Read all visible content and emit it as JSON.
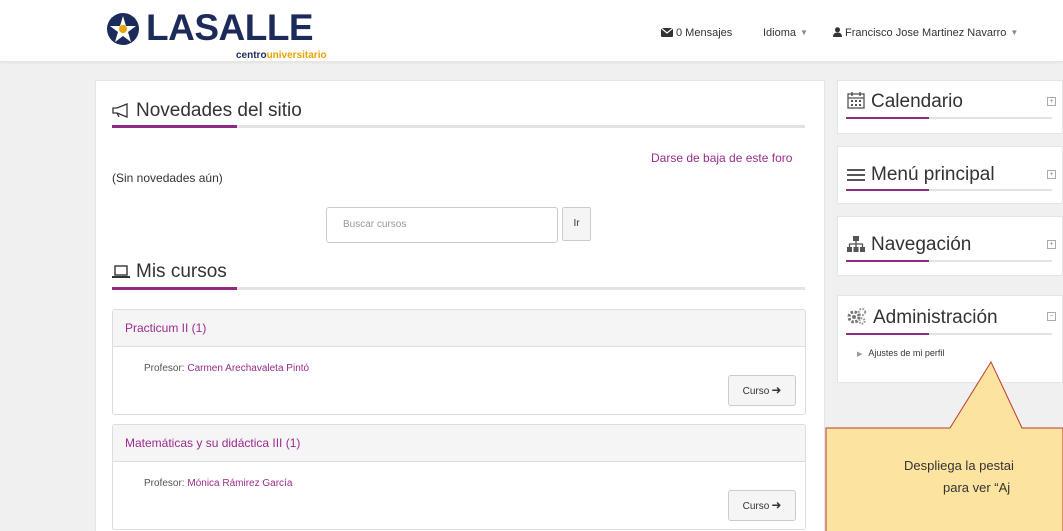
{
  "header": {
    "logo_text": "LASALLE",
    "logo_sub_a": "centro",
    "logo_sub_b": "universitario",
    "messages_label": "0 Mensajes",
    "language_label": "Idioma",
    "user_label": "Francisco Jose Martinez Navarro"
  },
  "news": {
    "title": "Novedades del sitio",
    "unsubscribe_link": "Darse de baja de este foro",
    "empty_text": "(Sin novedades aún)"
  },
  "search": {
    "placeholder": "Buscar cursos",
    "button_label": "Ir"
  },
  "my_courses": {
    "title": "Mis cursos",
    "courses": [
      {
        "name": "Practicum II (1)",
        "teacher_label": "Profesor: ",
        "teacher_name": "Carmen Arechavaleta Pintó",
        "button_label": "Curso"
      },
      {
        "name": "Matemáticas y su didáctica III (1)",
        "teacher_label": "Profesor: ",
        "teacher_name": "Mónica Rámirez García",
        "button_label": "Curso"
      }
    ]
  },
  "sidebar": {
    "blocks": [
      {
        "title": "Calendario",
        "icon": "calendar-icon",
        "control": "+"
      },
      {
        "title": "Menú principal",
        "icon": "menu-icon",
        "control": "+"
      },
      {
        "title": "Navegación",
        "icon": "sitemap-icon",
        "control": "+"
      },
      {
        "title": "Administración",
        "icon": "gears-icon",
        "control": "−",
        "items": [
          "Ajustes de mi perfil"
        ]
      }
    ]
  },
  "callout": {
    "line1": "Despliega la pestai",
    "line2": "para ver “Aj"
  },
  "colors": {
    "accent": "#8e2a82",
    "link": "#9b2b8e",
    "brand_navy": "#1c2b5a",
    "brand_gold": "#e7a300",
    "callout_fill": "#fde3a0",
    "callout_border": "#c0392b"
  }
}
